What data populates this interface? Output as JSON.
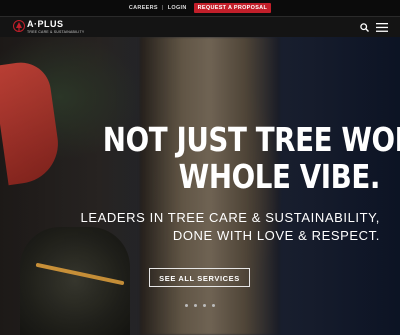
{
  "topbar": {
    "careers": "CAREERS",
    "separator": "|",
    "login": "LOGIN",
    "request": "REQUEST A PROPOSAL"
  },
  "logo": {
    "name": "A·PLUS",
    "tagline": "TREE CARE & SUSTAINABILITY"
  },
  "icons": {
    "search": "search-icon",
    "menu": "hamburger-menu-icon"
  },
  "hero": {
    "headline_line1": "NOT JUST TREE WORK, A",
    "headline_line2": "WHOLE VIBE.",
    "sub_line1": "LEADERS IN TREE CARE & SUSTAINABILITY,",
    "sub_line2": "DONE WITH LOVE & RESPECT.",
    "cta": "SEE ALL SERVICES",
    "slide_count": 4
  },
  "colors": {
    "accent": "#c21f2a",
    "nav_bg": "#141414"
  }
}
